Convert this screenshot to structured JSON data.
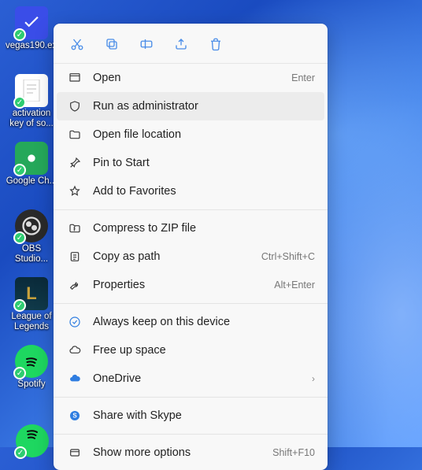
{
  "desktop_icons": [
    {
      "label": "vegas190.ex..."
    },
    {
      "label": "activation key of so..."
    },
    {
      "label": "Google Ch..."
    },
    {
      "label": "OBS Studio..."
    },
    {
      "label": "League of Legends"
    },
    {
      "label": "Spotify"
    }
  ],
  "quick_actions": {
    "cut": "Cut",
    "copy": "Copy",
    "rename": "Rename",
    "share": "Share",
    "delete": "Delete"
  },
  "menu": {
    "open": {
      "label": "Open",
      "accel": "Enter"
    },
    "run_admin": {
      "label": "Run as administrator"
    },
    "open_location": {
      "label": "Open file location"
    },
    "pin_start": {
      "label": "Pin to Start"
    },
    "add_favorites": {
      "label": "Add to Favorites"
    },
    "compress_zip": {
      "label": "Compress to ZIP file"
    },
    "copy_path": {
      "label": "Copy as path",
      "accel": "Ctrl+Shift+C"
    },
    "properties": {
      "label": "Properties",
      "accel": "Alt+Enter"
    },
    "always_keep": {
      "label": "Always keep on this device"
    },
    "free_space": {
      "label": "Free up space"
    },
    "onedrive": {
      "label": "OneDrive"
    },
    "share_skype": {
      "label": "Share with Skype"
    },
    "more_options": {
      "label": "Show more options",
      "accel": "Shift+F10"
    }
  }
}
